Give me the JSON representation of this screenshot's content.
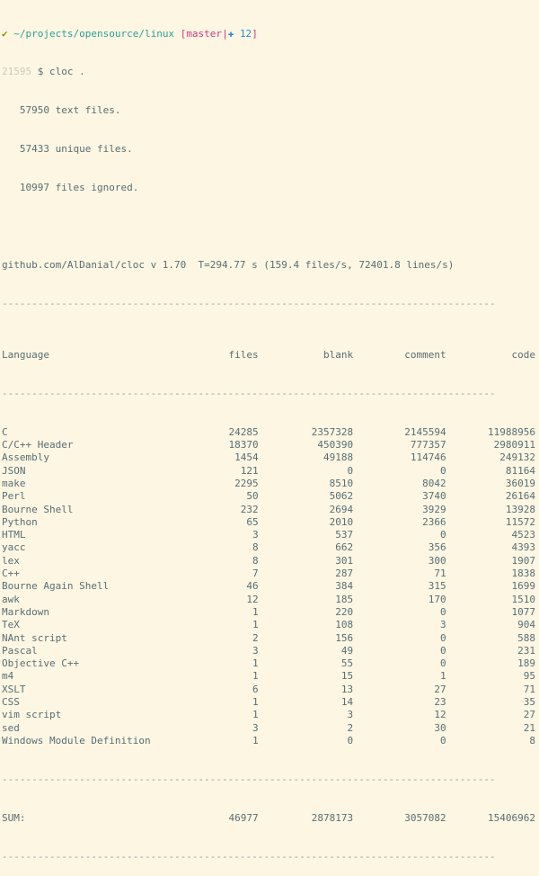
{
  "prompt": {
    "check": "✔",
    "path": "~/projects/opensource/linux",
    "branch_open": "[",
    "branch": "master",
    "branch_sep": "|",
    "plus": "✚",
    "changes": "12",
    "branch_close": "]",
    "history_num": "21595",
    "dollar": "$",
    "command": "cloc ."
  },
  "summary": [
    "57950 text files.",
    "57433 unique files.",
    "10997 files ignored."
  ],
  "stats_line": "github.com/AlDanial/cloc v 1.70  T=294.77 s (159.4 files/s, 72401.8 lines/s)",
  "dashes": "-----------------------------------------------------------------------------------",
  "headers": {
    "language": "Language",
    "files": "files",
    "blank": "blank",
    "comment": "comment",
    "code": "code"
  },
  "rows": [
    {
      "language": "C",
      "files": "24285",
      "blank": "2357328",
      "comment": "2145594",
      "code": "11988956"
    },
    {
      "language": "C/C++ Header",
      "files": "18370",
      "blank": "450390",
      "comment": "777357",
      "code": "2980911"
    },
    {
      "language": "Assembly",
      "files": "1454",
      "blank": "49188",
      "comment": "114746",
      "code": "249132"
    },
    {
      "language": "JSON",
      "files": "121",
      "blank": "0",
      "comment": "0",
      "code": "81164"
    },
    {
      "language": "make",
      "files": "2295",
      "blank": "8510",
      "comment": "8042",
      "code": "36019"
    },
    {
      "language": "Perl",
      "files": "50",
      "blank": "5062",
      "comment": "3740",
      "code": "26164"
    },
    {
      "language": "Bourne Shell",
      "files": "232",
      "blank": "2694",
      "comment": "3929",
      "code": "13928"
    },
    {
      "language": "Python",
      "files": "65",
      "blank": "2010",
      "comment": "2366",
      "code": "11572"
    },
    {
      "language": "HTML",
      "files": "3",
      "blank": "537",
      "comment": "0",
      "code": "4523"
    },
    {
      "language": "yacc",
      "files": "8",
      "blank": "662",
      "comment": "356",
      "code": "4393"
    },
    {
      "language": "lex",
      "files": "8",
      "blank": "301",
      "comment": "300",
      "code": "1907"
    },
    {
      "language": "C++",
      "files": "7",
      "blank": "287",
      "comment": "71",
      "code": "1838"
    },
    {
      "language": "Bourne Again Shell",
      "files": "46",
      "blank": "384",
      "comment": "315",
      "code": "1699"
    },
    {
      "language": "awk",
      "files": "12",
      "blank": "185",
      "comment": "170",
      "code": "1510"
    },
    {
      "language": "Markdown",
      "files": "1",
      "blank": "220",
      "comment": "0",
      "code": "1077"
    },
    {
      "language": "TeX",
      "files": "1",
      "blank": "108",
      "comment": "3",
      "code": "904"
    },
    {
      "language": "NAnt script",
      "files": "2",
      "blank": "156",
      "comment": "0",
      "code": "588"
    },
    {
      "language": "Pascal",
      "files": "3",
      "blank": "49",
      "comment": "0",
      "code": "231"
    },
    {
      "language": "Objective C++",
      "files": "1",
      "blank": "55",
      "comment": "0",
      "code": "189"
    },
    {
      "language": "m4",
      "files": "1",
      "blank": "15",
      "comment": "1",
      "code": "95"
    },
    {
      "language": "XSLT",
      "files": "6",
      "blank": "13",
      "comment": "27",
      "code": "71"
    },
    {
      "language": "CSS",
      "files": "1",
      "blank": "14",
      "comment": "23",
      "code": "35"
    },
    {
      "language": "vim script",
      "files": "1",
      "blank": "3",
      "comment": "12",
      "code": "27"
    },
    {
      "language": "sed",
      "files": "3",
      "blank": "2",
      "comment": "30",
      "code": "21"
    },
    {
      "language": "Windows Module Definition",
      "files": "1",
      "blank": "0",
      "comment": "0",
      "code": "8"
    }
  ],
  "sum": {
    "language": "SUM:",
    "files": "46977",
    "blank": "2878173",
    "comment": "3057082",
    "code": "15406962"
  },
  "colors": {
    "background": "#fdf6e3",
    "text": "#586e75",
    "check": "#859900",
    "path": "#2aa198",
    "branch": "#d33682",
    "changes": "#268bd2"
  }
}
